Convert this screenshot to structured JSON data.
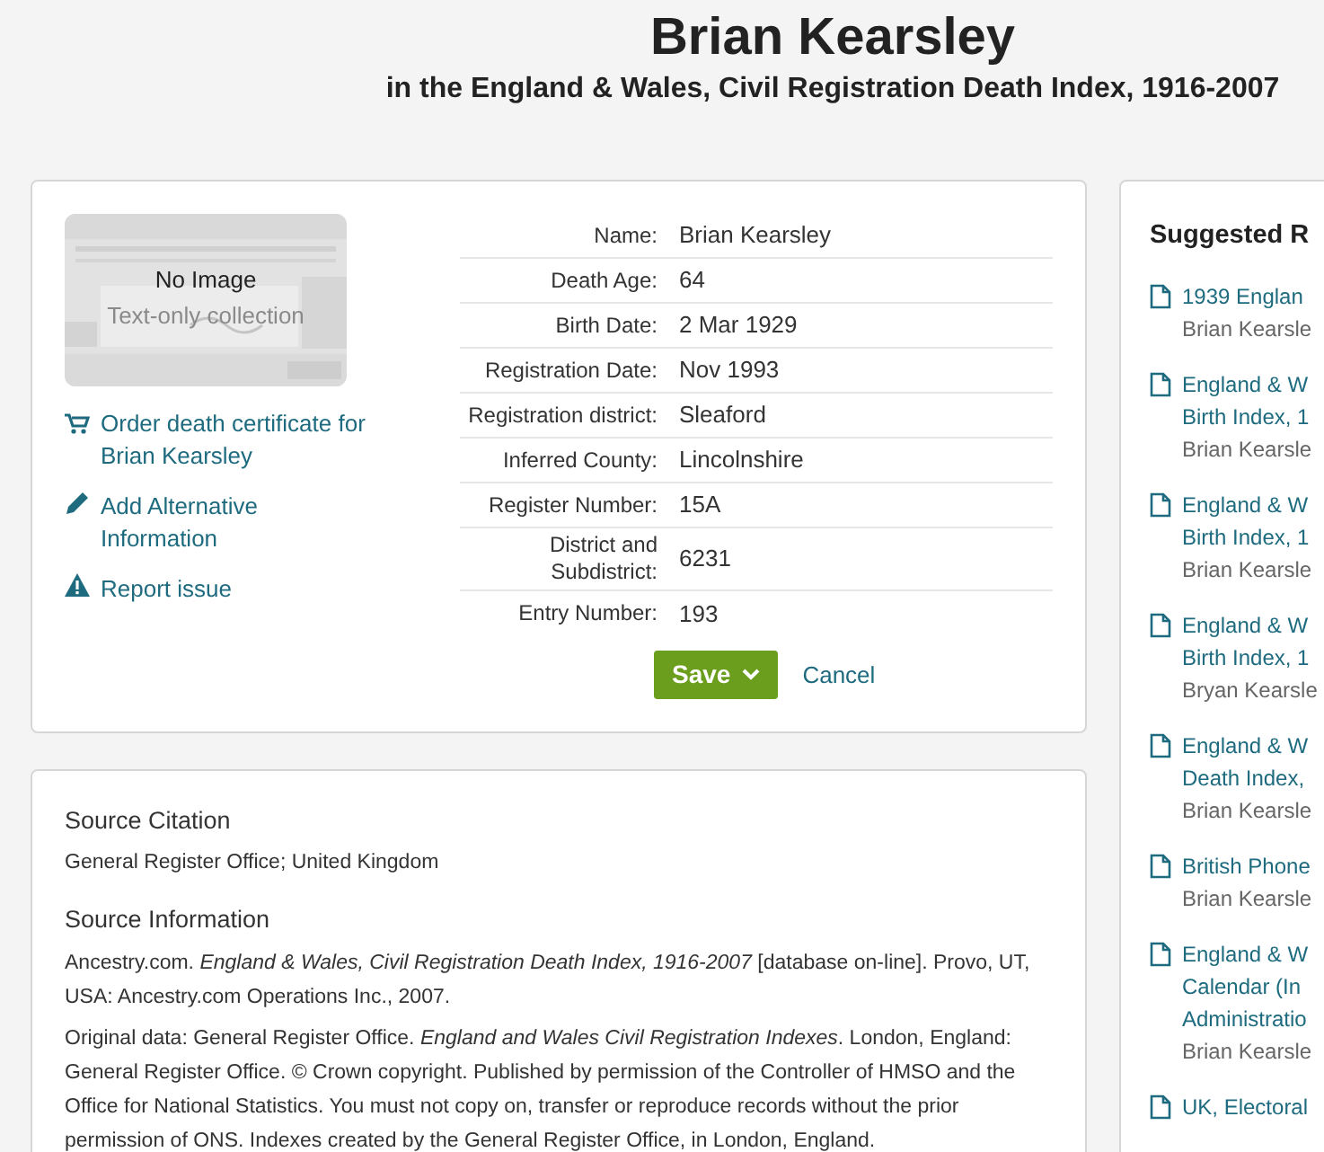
{
  "header": {
    "title": "Brian Kearsley",
    "subtitle": "in the England & Wales, Civil Registration Death Index, 1916-2007"
  },
  "thumbnail": {
    "label": "No Image",
    "caption": "Text-only collection"
  },
  "actions": [
    {
      "kind": "cart",
      "label": "Order death certificate for Brian Kearsley"
    },
    {
      "kind": "pencil",
      "label": "Add Alternative Information"
    },
    {
      "kind": "warning",
      "label": "Report issue"
    }
  ],
  "fields": [
    {
      "label": "Name:",
      "value": "Brian Kearsley"
    },
    {
      "label": "Death Age:",
      "value": "64"
    },
    {
      "label": "Birth Date:",
      "value": "2 Mar 1929"
    },
    {
      "label": "Registration Date:",
      "value": "Nov 1993"
    },
    {
      "label": "Registration district:",
      "value": "Sleaford"
    },
    {
      "label": "Inferred County:",
      "value": "Lincolnshire"
    },
    {
      "label": "Register Number:",
      "value": "15A"
    },
    {
      "label": "District and Subdistrict:",
      "value": "6231"
    },
    {
      "label": "Entry Number:",
      "value": "193"
    }
  ],
  "buttons": {
    "save": "Save",
    "cancel": "Cancel"
  },
  "source": [
    {
      "heading": "Source Citation",
      "paragraphs": [
        "General Register Office; United Kingdom"
      ]
    },
    {
      "heading": "Source Information",
      "paragraphs": [
        "Ancestry.com. *England & Wales, Civil Registration Death Index, 1916-2007* [database on-line]. Provo, UT, USA: Ancestry.com Operations Inc., 2007.",
        "Original data: General Register Office. *England and Wales Civil Registration Indexes*. London, England: General Register Office. © Crown copyright. Published by permission of the Controller of HMSO and the Office for National Statistics. You must not copy on, transfer or reproduce records without the prior permission of ONS. Indexes created by the General Register Office, in London, England."
      ]
    }
  ],
  "suggested": {
    "title": "Suggested R",
    "items": [
      {
        "title_lines": [
          "1939 Englan"
        ],
        "person": "Brian Kearsle"
      },
      {
        "title_lines": [
          "England & W",
          "Birth Index, 1"
        ],
        "person": "Brian Kearsle"
      },
      {
        "title_lines": [
          "England & W",
          "Birth Index, 1"
        ],
        "person": "Brian Kearsle"
      },
      {
        "title_lines": [
          "England & W",
          "Birth Index, 1"
        ],
        "person": "Bryan Kearsle"
      },
      {
        "title_lines": [
          "England & W",
          "Death Index,"
        ],
        "person": "Brian Kearsle"
      },
      {
        "title_lines": [
          "British Phone"
        ],
        "person": "Brian Kearsle"
      },
      {
        "title_lines": [
          "England & W",
          "Calendar (In",
          "Administratio"
        ],
        "person": "Brian Kearsle"
      },
      {
        "title_lines": [
          "UK, Electoral"
        ]
      }
    ]
  }
}
